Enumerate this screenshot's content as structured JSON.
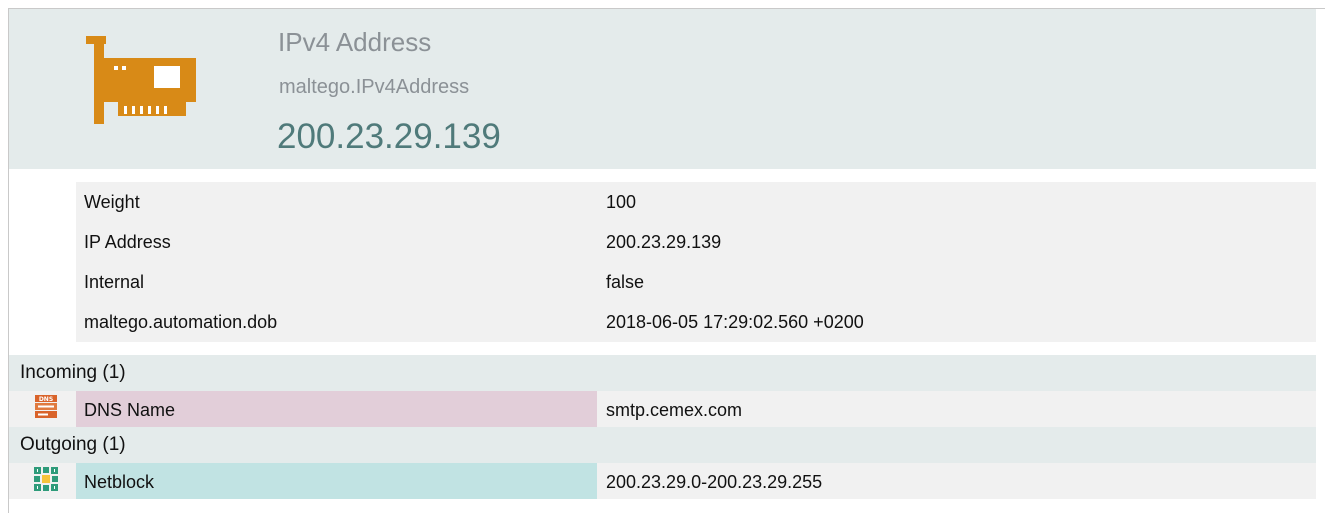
{
  "entity": {
    "icon": "network-card-icon",
    "type_label": "IPv4 Address",
    "type_id": "maltego.IPv4Address",
    "value": "200.23.29.139"
  },
  "properties": [
    {
      "key": "Weight",
      "value": "100"
    },
    {
      "key": "IP Address",
      "value": "200.23.29.139"
    },
    {
      "key": "Internal",
      "value": "false"
    },
    {
      "key": "maltego.automation.dob",
      "value": "2018-06-05 17:29:02.560 +0200"
    }
  ],
  "incoming": {
    "heading": "Incoming (1)",
    "links": [
      {
        "icon": "dns-server-icon",
        "type": "DNS Name",
        "value": "smtp.cemex.com",
        "color": "#e2ced9"
      }
    ]
  },
  "outgoing": {
    "heading": "Outgoing (1)",
    "links": [
      {
        "icon": "netblock-icon",
        "type": "Netblock",
        "value": "200.23.29.0-200.23.29.255",
        "color": "#c1e3e3"
      }
    ]
  },
  "colors": {
    "header_bg": "#e4ebeb",
    "row_bg": "#f1f1f1",
    "value_color": "#4f7a7a",
    "icon_orange": "#d88a17"
  }
}
